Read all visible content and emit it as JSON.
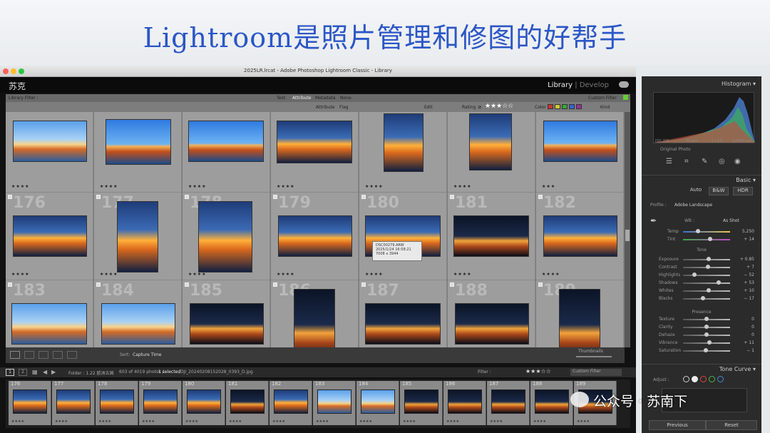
{
  "banner": {
    "title": "Lightroom是照片管理和修图的好帮手"
  },
  "window": {
    "title": "2025LR.lrcat - Adobe Photoshop Lightroom Classic - Library"
  },
  "identity_plate": "苏克",
  "modules": {
    "library": "Library",
    "separator": "|",
    "develop": "Develop"
  },
  "filter_bar": {
    "label": "Library Filter :",
    "tabs": [
      "Text",
      "Attribute",
      "Metadata",
      "None"
    ],
    "custom_filter": "Custom Filter",
    "attribute_label": "Attribute",
    "flag_label": "Flag",
    "edit_label": "Edit",
    "rating_label": "Rating",
    "rating_op": "≥",
    "color_label": "Color",
    "kind_label": "Kind"
  },
  "grid": {
    "rows": [
      {
        "cells": [
          {
            "num": "",
            "stars": "★★★★",
            "style": "dusk"
          },
          {
            "num": "",
            "stars": "★★★★",
            "style": "sky"
          },
          {
            "num": "",
            "stars": "★★★★",
            "style": "sky"
          },
          {
            "num": "",
            "stars": "★★★★",
            "style": "gold"
          },
          {
            "num": "",
            "stars": "★★★★",
            "style": "gold"
          },
          {
            "num": "",
            "stars": "★★★★",
            "style": "gold"
          },
          {
            "num": "",
            "stars": "★★★",
            "style": "sky"
          }
        ]
      },
      {
        "cells": [
          {
            "num": "176",
            "stars": "★★★★",
            "style": "gold"
          },
          {
            "num": "177",
            "stars": "★★★★",
            "style": "gold"
          },
          {
            "num": "178",
            "stars": "★★★★",
            "style": "gold"
          },
          {
            "num": "179",
            "stars": "★★★★",
            "style": "gold"
          },
          {
            "num": "180",
            "stars": "★★★★",
            "style": "gold"
          },
          {
            "num": "181",
            "stars": "★★★★",
            "style": "night"
          },
          {
            "num": "182",
            "stars": "★★★★",
            "style": "gold"
          }
        ]
      },
      {
        "cells": [
          {
            "num": "183",
            "stars": "★★★★",
            "style": "dusk"
          },
          {
            "num": "184",
            "stars": "★★★★",
            "style": "dusk"
          },
          {
            "num": "185",
            "stars": "★★★★",
            "style": "night"
          },
          {
            "num": "186",
            "stars": "★★★★",
            "style": "night"
          },
          {
            "num": "187",
            "stars": "★★★★",
            "style": "night"
          },
          {
            "num": "188",
            "stars": "★★★★",
            "style": "night"
          },
          {
            "num": "189",
            "stars": "★★★★",
            "style": "night"
          }
        ]
      }
    ],
    "tooltip": {
      "line1": "DSC00279.ARW",
      "line2": "2025/1/24 16:58:21",
      "line3": "7008 x 3944"
    }
  },
  "toolbar": {
    "sort_label": "Sort:",
    "sort_value": "Capture Time",
    "thumbnails_label": "Thumbnails"
  },
  "filmstrip_bar": {
    "page1": "1",
    "page2": "2",
    "folder_text": "Folder : 1.22 欧洲五国",
    "count_text": "603 of 4019 photos /",
    "selected_text": "1 selected",
    "path_text": "/DJI_20240208152028_0393_D.jpg",
    "filter_label": "Filter :",
    "custom_filter": "Custom Filter"
  },
  "filmstrip": [
    {
      "n": "176"
    },
    {
      "n": "177"
    },
    {
      "n": "178"
    },
    {
      "n": "179"
    },
    {
      "n": "180"
    },
    {
      "n": "181"
    },
    {
      "n": "182"
    },
    {
      "n": "183"
    },
    {
      "n": "184"
    },
    {
      "n": "185"
    },
    {
      "n": "186"
    },
    {
      "n": "187"
    },
    {
      "n": "188"
    },
    {
      "n": "189"
    }
  ],
  "right_panel": {
    "histogram_label": "Histogram",
    "histo_info": {
      "iso": "ISO 200",
      "focal": "70 mm",
      "aperture": "ƒ / 3.5",
      "shutter": "1/3200 sec"
    },
    "original_photo": "Original Photo",
    "basic_label": "Basic",
    "modes": {
      "auto": "Auto",
      "bw": "B&W",
      "hdr": "HDR"
    },
    "profile_label": "Profile :",
    "profile_value": "Adobe Landscape",
    "wb_label": "WB :",
    "wb_value": "As Shot",
    "temp": {
      "label": "Temp",
      "value": "5,250"
    },
    "tint": {
      "label": "Tint",
      "value": "+ 14"
    },
    "tone_label": "Tone",
    "sliders": [
      {
        "label": "Exposure",
        "value": "+ 0.85",
        "pos": 0.55
      },
      {
        "label": "Contrast",
        "value": "+ 7",
        "pos": 0.53
      },
      {
        "label": "Highlights",
        "value": "− 52",
        "pos": 0.24
      },
      {
        "label": "Shadows",
        "value": "+ 53",
        "pos": 0.76
      },
      {
        "label": "Whites",
        "value": "+ 10",
        "pos": 0.55
      },
      {
        "label": "Blacks",
        "value": "− 17",
        "pos": 0.42
      }
    ],
    "presence_label": "Presence",
    "presence": [
      {
        "label": "Texture",
        "value": "0",
        "pos": 0.5
      },
      {
        "label": "Clarity",
        "value": "0",
        "pos": 0.5
      },
      {
        "label": "Dehaze",
        "value": "0",
        "pos": 0.5
      },
      {
        "label": "Vibrance",
        "value": "+ 11",
        "pos": 0.56
      },
      {
        "label": "Saturation",
        "value": "− 1",
        "pos": 0.49
      }
    ],
    "tone_curve_label": "Tone Curve",
    "adjust_label": "Adjust :",
    "previous_label": "Previous",
    "reset_label": "Reset"
  },
  "watermark": "公众号 · 苏南下"
}
